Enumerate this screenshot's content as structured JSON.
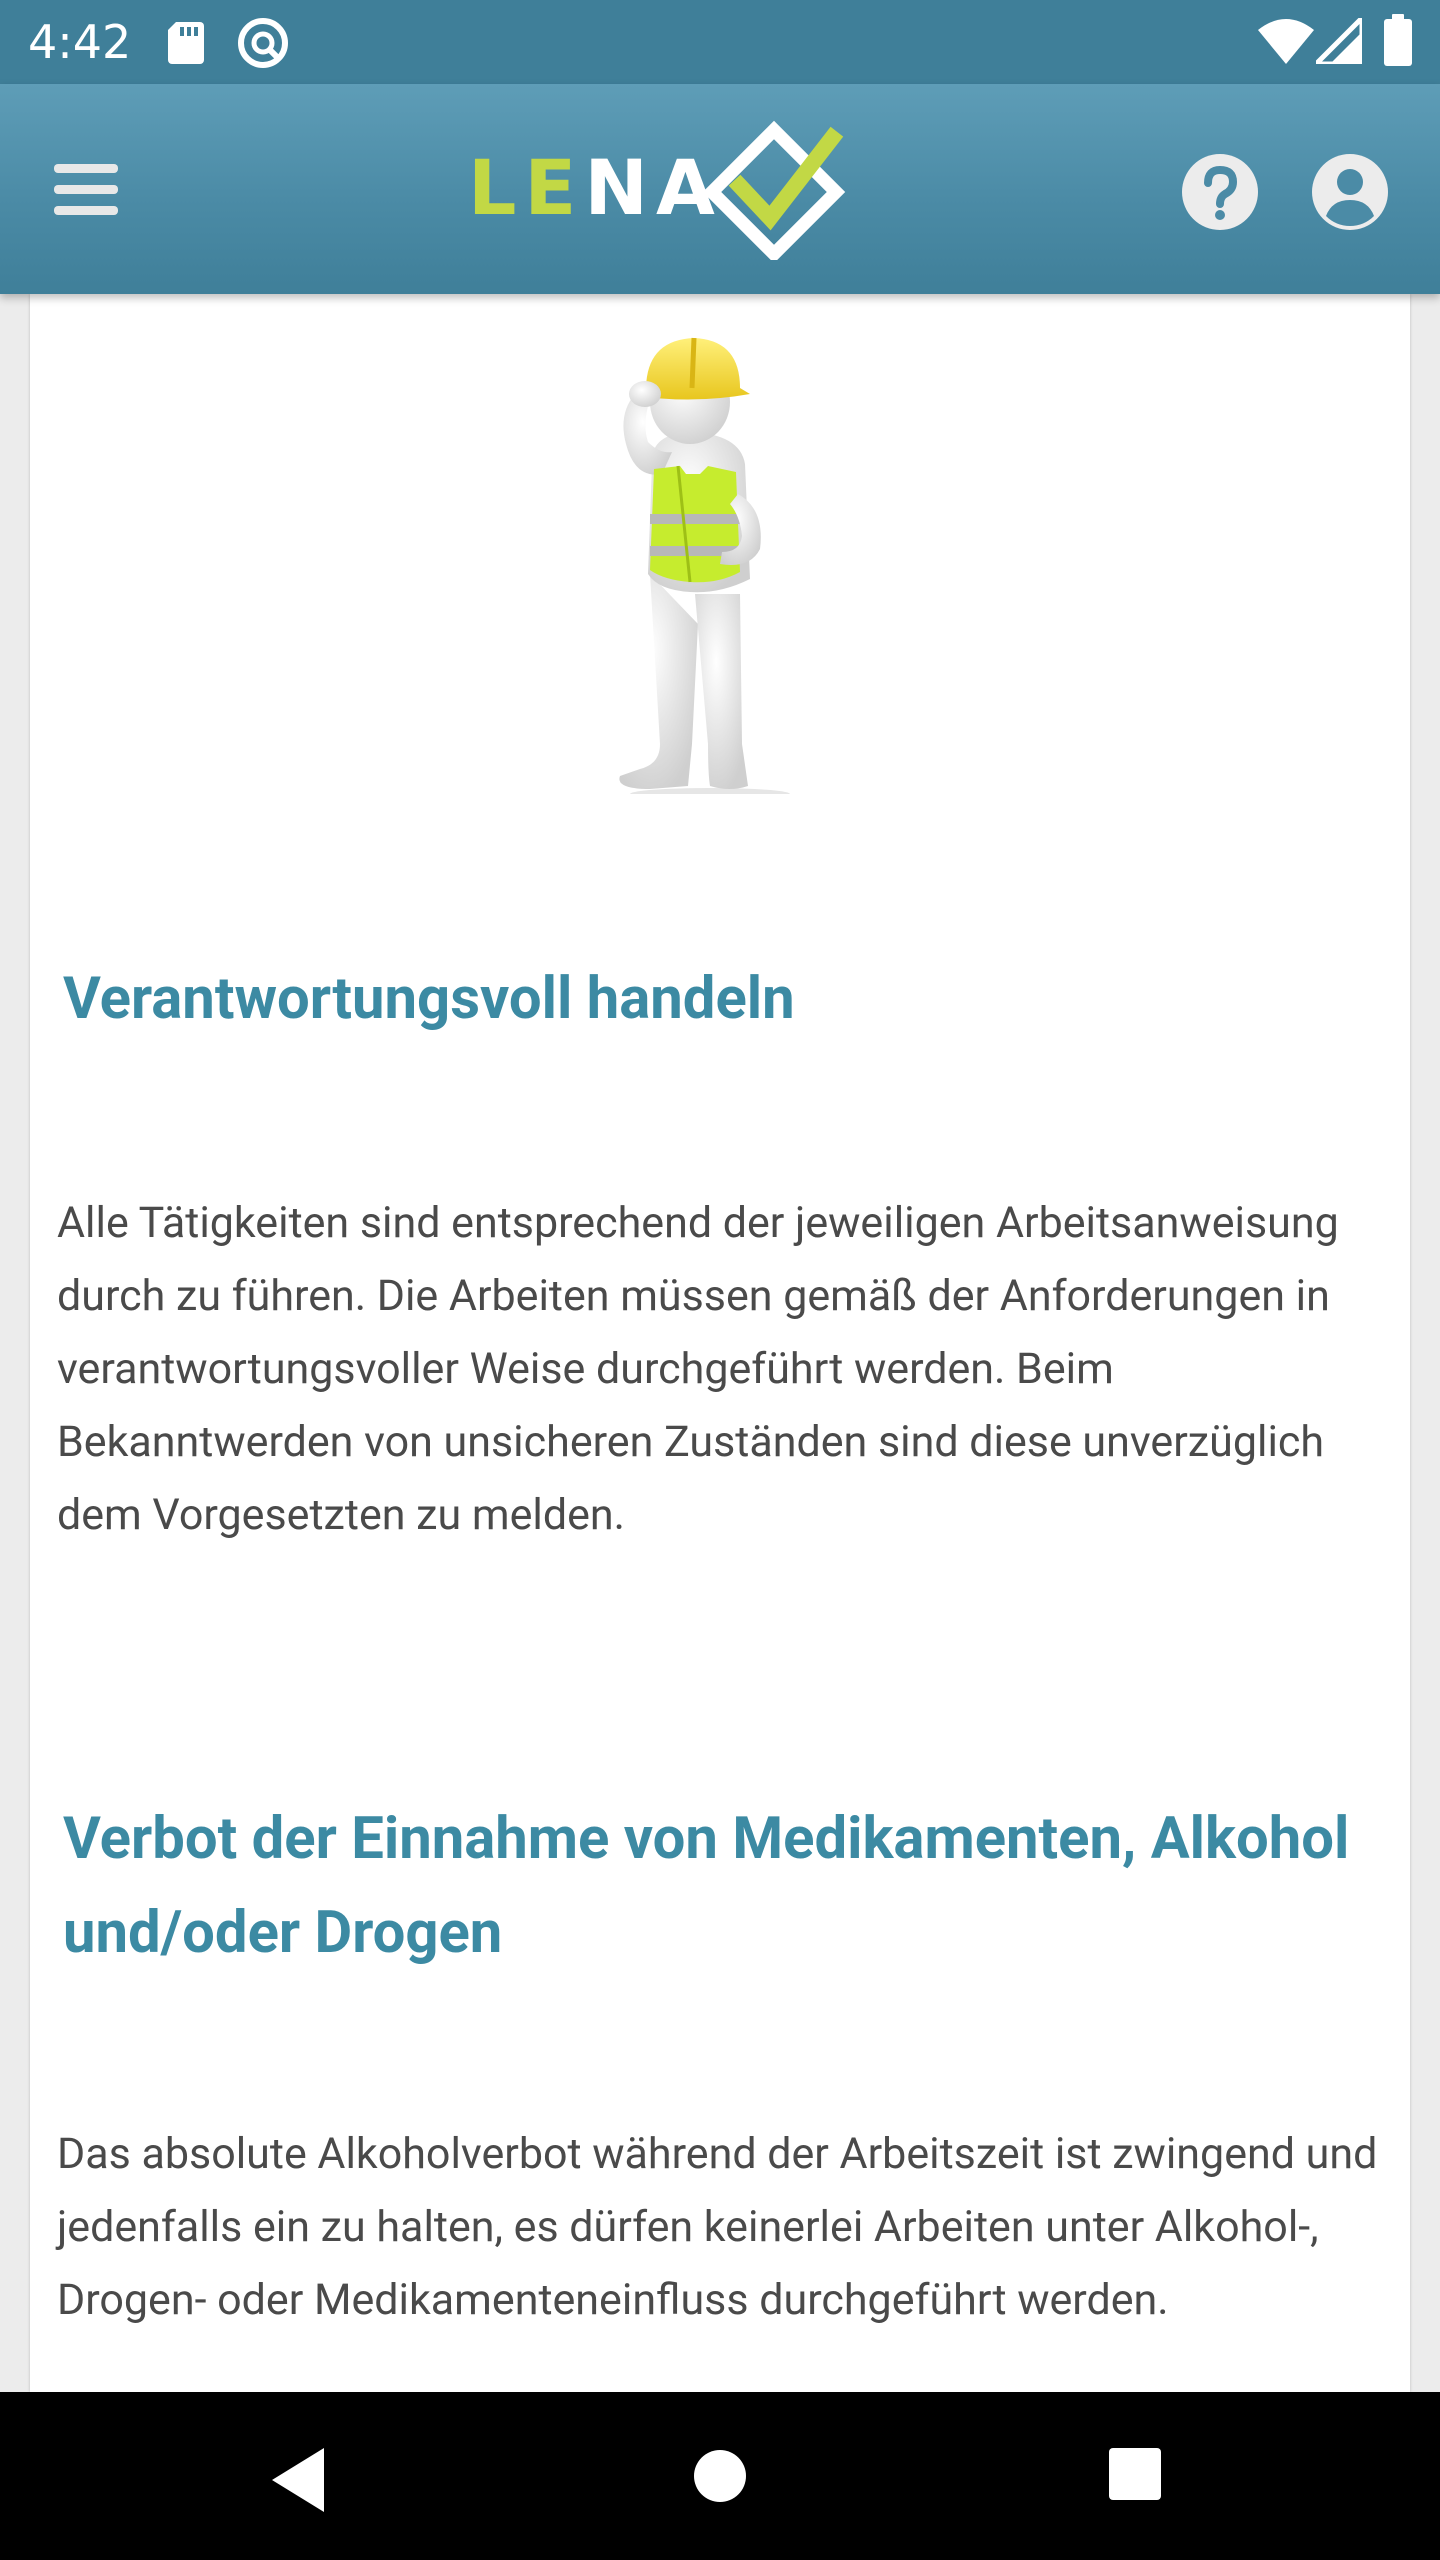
{
  "status_bar": {
    "time": "4:42",
    "left_icons": [
      "sd-card-icon",
      "sync-circle-icon"
    ],
    "right_icons": [
      "wifi-icon",
      "cellular-signal-icon",
      "battery-icon"
    ]
  },
  "app_bar": {
    "menu_icon": "hamburger-menu-icon",
    "logo": {
      "letters_lime": "LE",
      "letters_white": "NA",
      "mark": "diamond-checkmark-icon"
    },
    "help_icon": "help-circle-icon",
    "account_icon": "account-circle-icon"
  },
  "content": {
    "illustration": "construction-worker-figure-illustration",
    "sections": [
      {
        "heading": "Verantwortungsvoll handeln",
        "body": "Alle Tätigkeiten sind entsprechend der jeweiligen Arbeitsanweisung durch zu führen. Die Arbeiten müssen gemäß der Anforderungen in verantwortungsvoller Weise durchgeführt werden. Beim Bekanntwerden von unsicheren Zuständen sind diese unverzüglich dem Vorgesetzten zu melden."
      },
      {
        "heading": "Verbot der Einnahme von Medikamenten, Alkohol und/oder Drogen",
        "body": "Das absolute Alkoholverbot während der Arbeitszeit ist zwingend und jedenfalls ein zu halten, es dürfen keinerlei Arbeiten unter Alkohol-, Drogen- oder Medikamenteneinfluss durchgeführt werden."
      }
    ]
  },
  "nav_bar": {
    "icons": [
      "back-icon",
      "home-icon",
      "recents-icon"
    ]
  },
  "colors": {
    "status_bar": "#3f7f99",
    "app_bar": "#4b8ba6",
    "logo_lime": "#c2d845",
    "heading": "#3c8aa3",
    "body_text": "#4a4a4a",
    "nav_bar": "#000000"
  }
}
